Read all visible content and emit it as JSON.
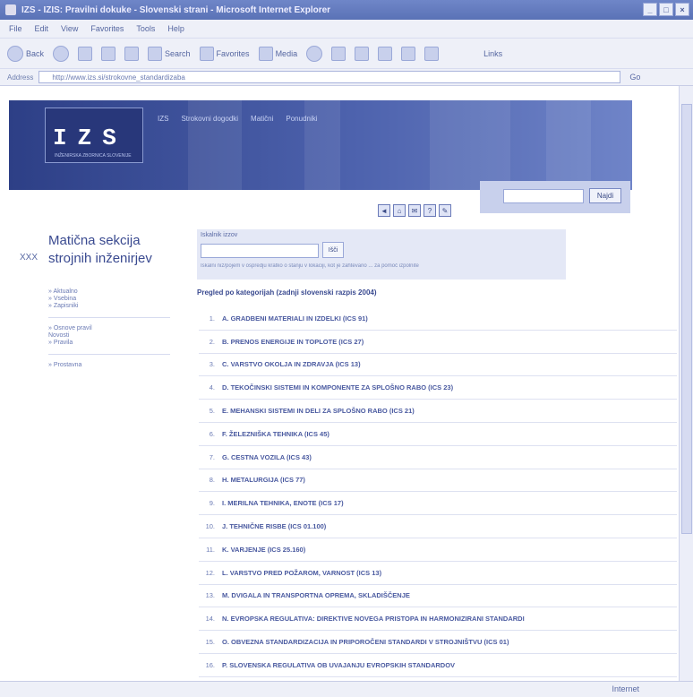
{
  "window": {
    "title": "IZS - IZIS: Pravilni dokuke - Slovenski strani - Microsoft Internet Explorer",
    "buttons": [
      "_",
      "□",
      "×"
    ]
  },
  "menu": [
    "File",
    "Edit",
    "View",
    "Favorites",
    "Tools",
    "Help"
  ],
  "toolbar": {
    "back": "Back",
    "search": "Search",
    "favorites": "Favorites",
    "media": "Media",
    "links": "Links"
  },
  "address": {
    "label": "Address",
    "url": "http://www.izs.si/strokovne_standardizaba",
    "go": "Go"
  },
  "banner": {
    "logo_letters": "IZS",
    "logo_sub": "INŽENIRSKA ZBORNICA SLOVENIJE",
    "nav": [
      "IZS",
      "Strokovni dogodki",
      "Matični",
      "Ponudniki"
    ]
  },
  "search": {
    "button": "Najdi",
    "placeholder": ""
  },
  "icons_bar": [
    "◄",
    "⌂",
    "✉",
    "?",
    "✎"
  ],
  "section_title": "Matična sekcija strojnih inženirjev",
  "xxx_label": "XXX",
  "sidenav": {
    "group1": [
      "» Aktualno",
      "» Vsebina",
      "» Zapisniki"
    ],
    "group2": [
      "» Osnove pravil",
      "Novosti",
      "» Pravila"
    ],
    "group3": [
      "» Prostavna"
    ]
  },
  "panel": {
    "label": "Iskalnik izzov",
    "button": "Išči",
    "hint": "Iskalni niz/pojem v ospredju kratko o stanju v lokaciji, kot je zahtevano ... za pomoč izpolnite"
  },
  "list_heading": "Pregled po kategorijah (zadnji slovenski razpis 2004)",
  "list": [
    {
      "num": "1.",
      "text": "A. GRADBENI MATERIALI IN IZDELKI (ICS 91)"
    },
    {
      "num": "2.",
      "text": "B. PRENOS ENERGIJE IN TOPLOTE (ICS 27)"
    },
    {
      "num": "3.",
      "text": "C. VARSTVO OKOLJA IN ZDRAVJA (ICS 13)"
    },
    {
      "num": "4.",
      "text": "D. TEKOČINSKI SISTEMI IN KOMPONENTE ZA SPLOŠNO RABO (ICS 23)"
    },
    {
      "num": "5.",
      "text": "E. MEHANSKI SISTEMI IN DELI ZA SPLOŠNO RABO (ICS 21)"
    },
    {
      "num": "6.",
      "text": "F. ŽELEZNIŠKA TEHNIKA (ICS 45)"
    },
    {
      "num": "7.",
      "text": "G. CESTNA VOZILA (ICS 43)"
    },
    {
      "num": "8.",
      "text": "H. METALURGIJA (ICS 77)"
    },
    {
      "num": "9.",
      "text": "I. MERILNA TEHNIKA, ENOTE (ICS 17)"
    },
    {
      "num": "10.",
      "text": "J. TEHNIČNE RISBE (ICS 01.100)"
    },
    {
      "num": "11.",
      "text": "K. VARJENJE (ICS 25.160)"
    },
    {
      "num": "12.",
      "text": "L. VARSTVO PRED POŽAROM, VARNOST (ICS 13)"
    },
    {
      "num": "13.",
      "text": "M. DVIGALA IN TRANSPORTNA OPREMA, SKLADIŠČENJE"
    },
    {
      "num": "14.",
      "text": "N. EVROPSKA REGULATIVA: DIREKTIVE NOVEGA PRISTOPA IN HARMONIZIRANI STANDARDI"
    },
    {
      "num": "15.",
      "text": "O. OBVEZNA STANDARDIZACIJA IN PRIPOROČENI STANDARDI V STROJNIŠTVU (ICS 01)"
    },
    {
      "num": "16.",
      "text": "P. SLOVENSKA REGULATIVA OB UVAJANJU EVROPSKIH STANDARDOV"
    }
  ],
  "status": {
    "zone": "Internet"
  }
}
